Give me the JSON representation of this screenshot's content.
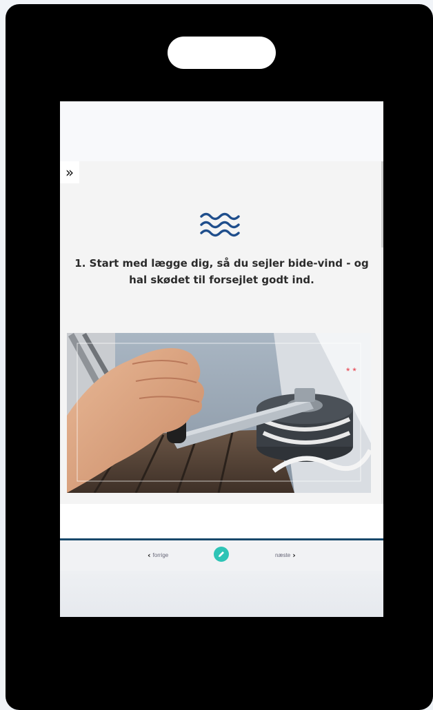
{
  "slide": {
    "title": "1. Start med lægge dig, så du sejler bide-vind - og hal skødet til forsejlet godt ind.",
    "icon": "waves-icon",
    "photo": "hand-cranking-winch-photo"
  },
  "sidebar_toggle": {
    "icon": "double-chevron-right-icon",
    "glyph": "»"
  },
  "nav": {
    "prev_label": "forrige",
    "next_label": "næste",
    "prev_glyph": "‹",
    "next_glyph": "›",
    "edit_icon": "pencil-icon"
  },
  "colors": {
    "wave": "#1f4e8c",
    "nav_line": "#17486a",
    "edit_button": "#2ec4b6"
  }
}
